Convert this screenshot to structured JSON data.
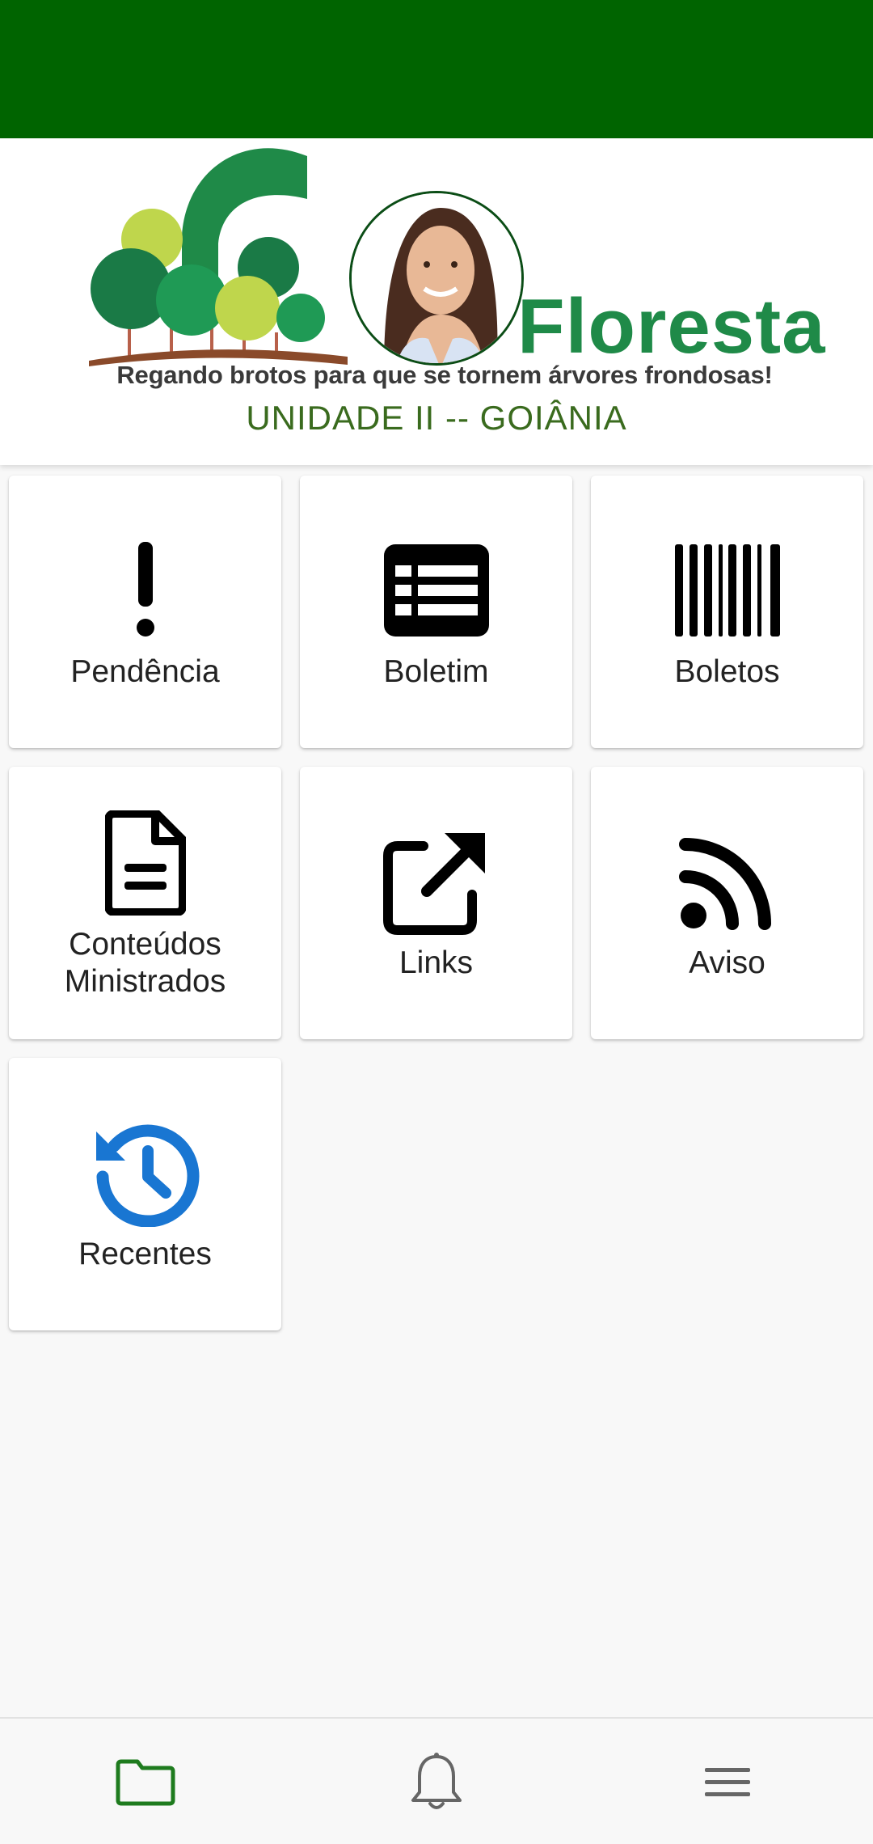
{
  "header": {
    "logo": {
      "word": "Floresta",
      "tagline": "Regando brotos para que se tornem árvores frondosas!",
      "unit": "UNIDADE II -- GOIÂNIA"
    }
  },
  "menu": {
    "tiles": [
      {
        "label": "Pendência",
        "icon": "exclamation-icon"
      },
      {
        "label": "Boletim",
        "icon": "list-table-icon"
      },
      {
        "label": "Boletos",
        "icon": "barcode-icon"
      },
      {
        "label": "Conteúdos Ministrados",
        "icon": "document-icon"
      },
      {
        "label": "Links",
        "icon": "external-link-icon"
      },
      {
        "label": "Aviso",
        "icon": "rss-icon"
      },
      {
        "label": "Recentes",
        "icon": "history-icon"
      }
    ]
  },
  "bottom_nav": {
    "items": [
      {
        "icon": "folder-icon",
        "active": true
      },
      {
        "icon": "bell-icon",
        "active": false
      },
      {
        "icon": "menu-icon",
        "active": false
      }
    ]
  },
  "colors": {
    "status_bar": "#006400",
    "active_nav": "#1e7b1e",
    "recentes_icon": "#1976d2"
  }
}
